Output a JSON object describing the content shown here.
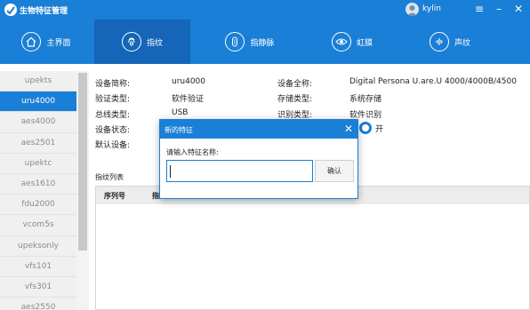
{
  "app": {
    "title": "生物特征管理"
  },
  "user": {
    "name": "kylin"
  },
  "window_controls": {
    "menu": "≡",
    "minimize": "–",
    "close": "✕"
  },
  "nav": {
    "items": [
      {
        "label": "主界面",
        "icon": "home-icon"
      },
      {
        "label": "指纹",
        "icon": "fingerprint-icon",
        "active": true
      },
      {
        "label": "指静脉",
        "icon": "finger-vein-icon"
      },
      {
        "label": "虹膜",
        "icon": "iris-icon"
      },
      {
        "label": "声纹",
        "icon": "voiceprint-icon"
      }
    ]
  },
  "sidebar": {
    "items": [
      "upekts",
      "uru4000",
      "aes4000",
      "aes2501",
      "upektc",
      "aes1610",
      "fdu2000",
      "vcom5s",
      "upeksonly",
      "vfs101",
      "vfs301",
      "aes2550"
    ],
    "active_index": 1
  },
  "device_info": {
    "name_label": "设备简称:",
    "name_value": "uru4000",
    "fullname_label": "设备全称:",
    "fullname_value": "Digital Persona U.are.U 4000/4000B/4500",
    "verify_type_label": "验证类型:",
    "verify_type_value": "软件验证",
    "storage_type_label": "存储类型:",
    "storage_type_value": "系统存储",
    "bus_type_label": "总线类型:",
    "bus_type_value": "USB",
    "identify_type_label": "识别类型:",
    "identify_type_value": "软件识别",
    "status_label": "设备状态:",
    "status_toggle_label": "开",
    "default_label": "默认设备:"
  },
  "fingerprint_list": {
    "title": "指纹列表",
    "columns": [
      "序列号",
      "指"
    ]
  },
  "dialog": {
    "title": "新的特征",
    "prompt": "请输入特征名称:",
    "input_value": "",
    "confirm_label": "确认",
    "close": "✕"
  },
  "colors": {
    "primary": "#1a7fd6",
    "nav_active": "#1565b8"
  }
}
